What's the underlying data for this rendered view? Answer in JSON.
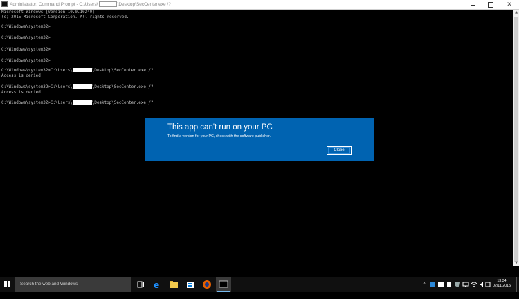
{
  "window": {
    "title_prefix": "Administrator: Command Prompt - C:\\Users\\",
    "title_suffix": "\\Desktop\\SecCenter.exe  /?",
    "minimize_icon": "minimize-icon",
    "maximize_icon": "maximize-icon",
    "close_glyph": "✕"
  },
  "console": {
    "lines": [
      {
        "text": "Microsoft Windows [Version 10.0.10240]"
      },
      {
        "text": "(c) 2015 Microsoft Corporation. All rights reserved."
      },
      {
        "text": "C:\\Windows\\system32>"
      },
      {
        "text": "C:\\Windows\\system32>"
      },
      {
        "text": "C:\\Windows\\system32>"
      },
      {
        "text": "C:\\Windows\\system32>"
      },
      {
        "pre": "C:\\Windows\\system32>C:\\Users\\",
        "post": "\\Desktop\\SecCenter.exe /?"
      },
      {
        "text": "Access is denied."
      },
      {
        "pre": "C:\\Windows\\system32>C:\\Users\\",
        "post": "\\Desktop\\SecCenter.exe /?"
      },
      {
        "text": "Access is denied."
      },
      {
        "pre": "C:\\Windows\\system32>C:\\Users\\",
        "post": "\\Desktop\\SecCenter.exe /?"
      }
    ]
  },
  "dialog": {
    "title": "This app can't run on your PC",
    "message": "To find a version for your PC, check with the software publisher.",
    "close_label": "Close",
    "background": "#0063b1"
  },
  "taskbar": {
    "search_placeholder": "Search the web and Windows",
    "clock_time": "13:34",
    "clock_date": "02/11/2015",
    "accent": "#76b9ed"
  }
}
